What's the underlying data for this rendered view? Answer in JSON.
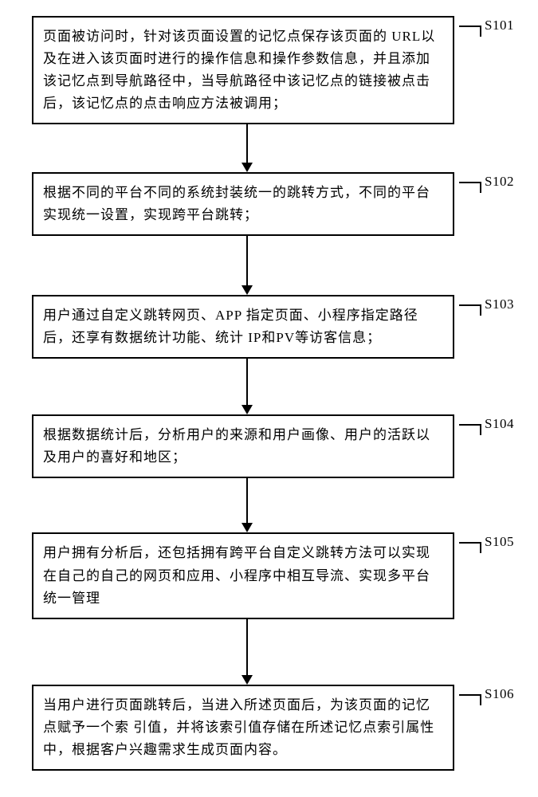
{
  "flow": {
    "steps": [
      {
        "label": "S101",
        "text": "页面被访问时，针对该页面设置的记忆点保存该页面的 URL以及在进入该页面时进行的操作信息和操作参数信息，并且添加该记忆点到导航路径中，当导航路径中该记忆点的链接被点击后，该记忆点的点击响应方法被调用；",
        "arrow_height": 48
      },
      {
        "label": "S102",
        "text": "根据不同的平台不同的系统封装统一的跳转方式，不同的平台实现统一设置，实现跨平台跳转；",
        "arrow_height": 62
      },
      {
        "label": "S103",
        "text": "用户通过自定义跳转网页、APP 指定页面、小程序指定路径后，还享有数据统计功能、统计 IP和PV等访客信息；",
        "arrow_height": 58
      },
      {
        "label": "S104",
        "text": "根据数据统计后，分析用户的来源和用户画像、用户的活跃以及用户的喜好和地区；",
        "arrow_height": 56
      },
      {
        "label": "S105",
        "text": "用户拥有分析后，还包括拥有跨平台自定义跳转方法可以实现在自己的自己的网页和应用、小程序中相互导流、实现多平台统一管理",
        "arrow_height": 70
      },
      {
        "label": "S106",
        "text": "当用户进行页面跳转后，当进入所述页面后，为该页面的记忆点赋予一个索   引值，并将该索引值存储在所述记忆点索引属性中，根据客户兴趣需求生成页面内容。",
        "arrow_height": 0
      }
    ]
  }
}
